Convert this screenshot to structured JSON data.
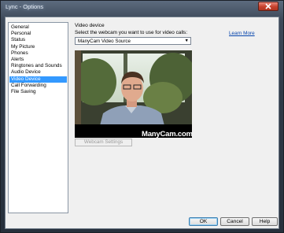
{
  "window": {
    "title": "Lync - Options"
  },
  "nav": {
    "items": [
      {
        "label": "General"
      },
      {
        "label": "Personal"
      },
      {
        "label": "Status"
      },
      {
        "label": "My Picture"
      },
      {
        "label": "Phones"
      },
      {
        "label": "Alerts"
      },
      {
        "label": "Ringtones and Sounds"
      },
      {
        "label": "Audio Device"
      },
      {
        "label": "Video Device",
        "selected": true
      },
      {
        "label": "Call Forwarding"
      },
      {
        "label": "File Saving"
      }
    ]
  },
  "video_device": {
    "heading": "Video device",
    "select_label": "Select the webcam you want to use for video calls:",
    "learn_more": "Learn More",
    "selected_webcam": "ManyCam Video Source",
    "watermark": "ManyCam.com",
    "settings_button": "Webcam Settings"
  },
  "buttons": {
    "ok": "OK",
    "cancel": "Cancel",
    "help": "Help"
  }
}
